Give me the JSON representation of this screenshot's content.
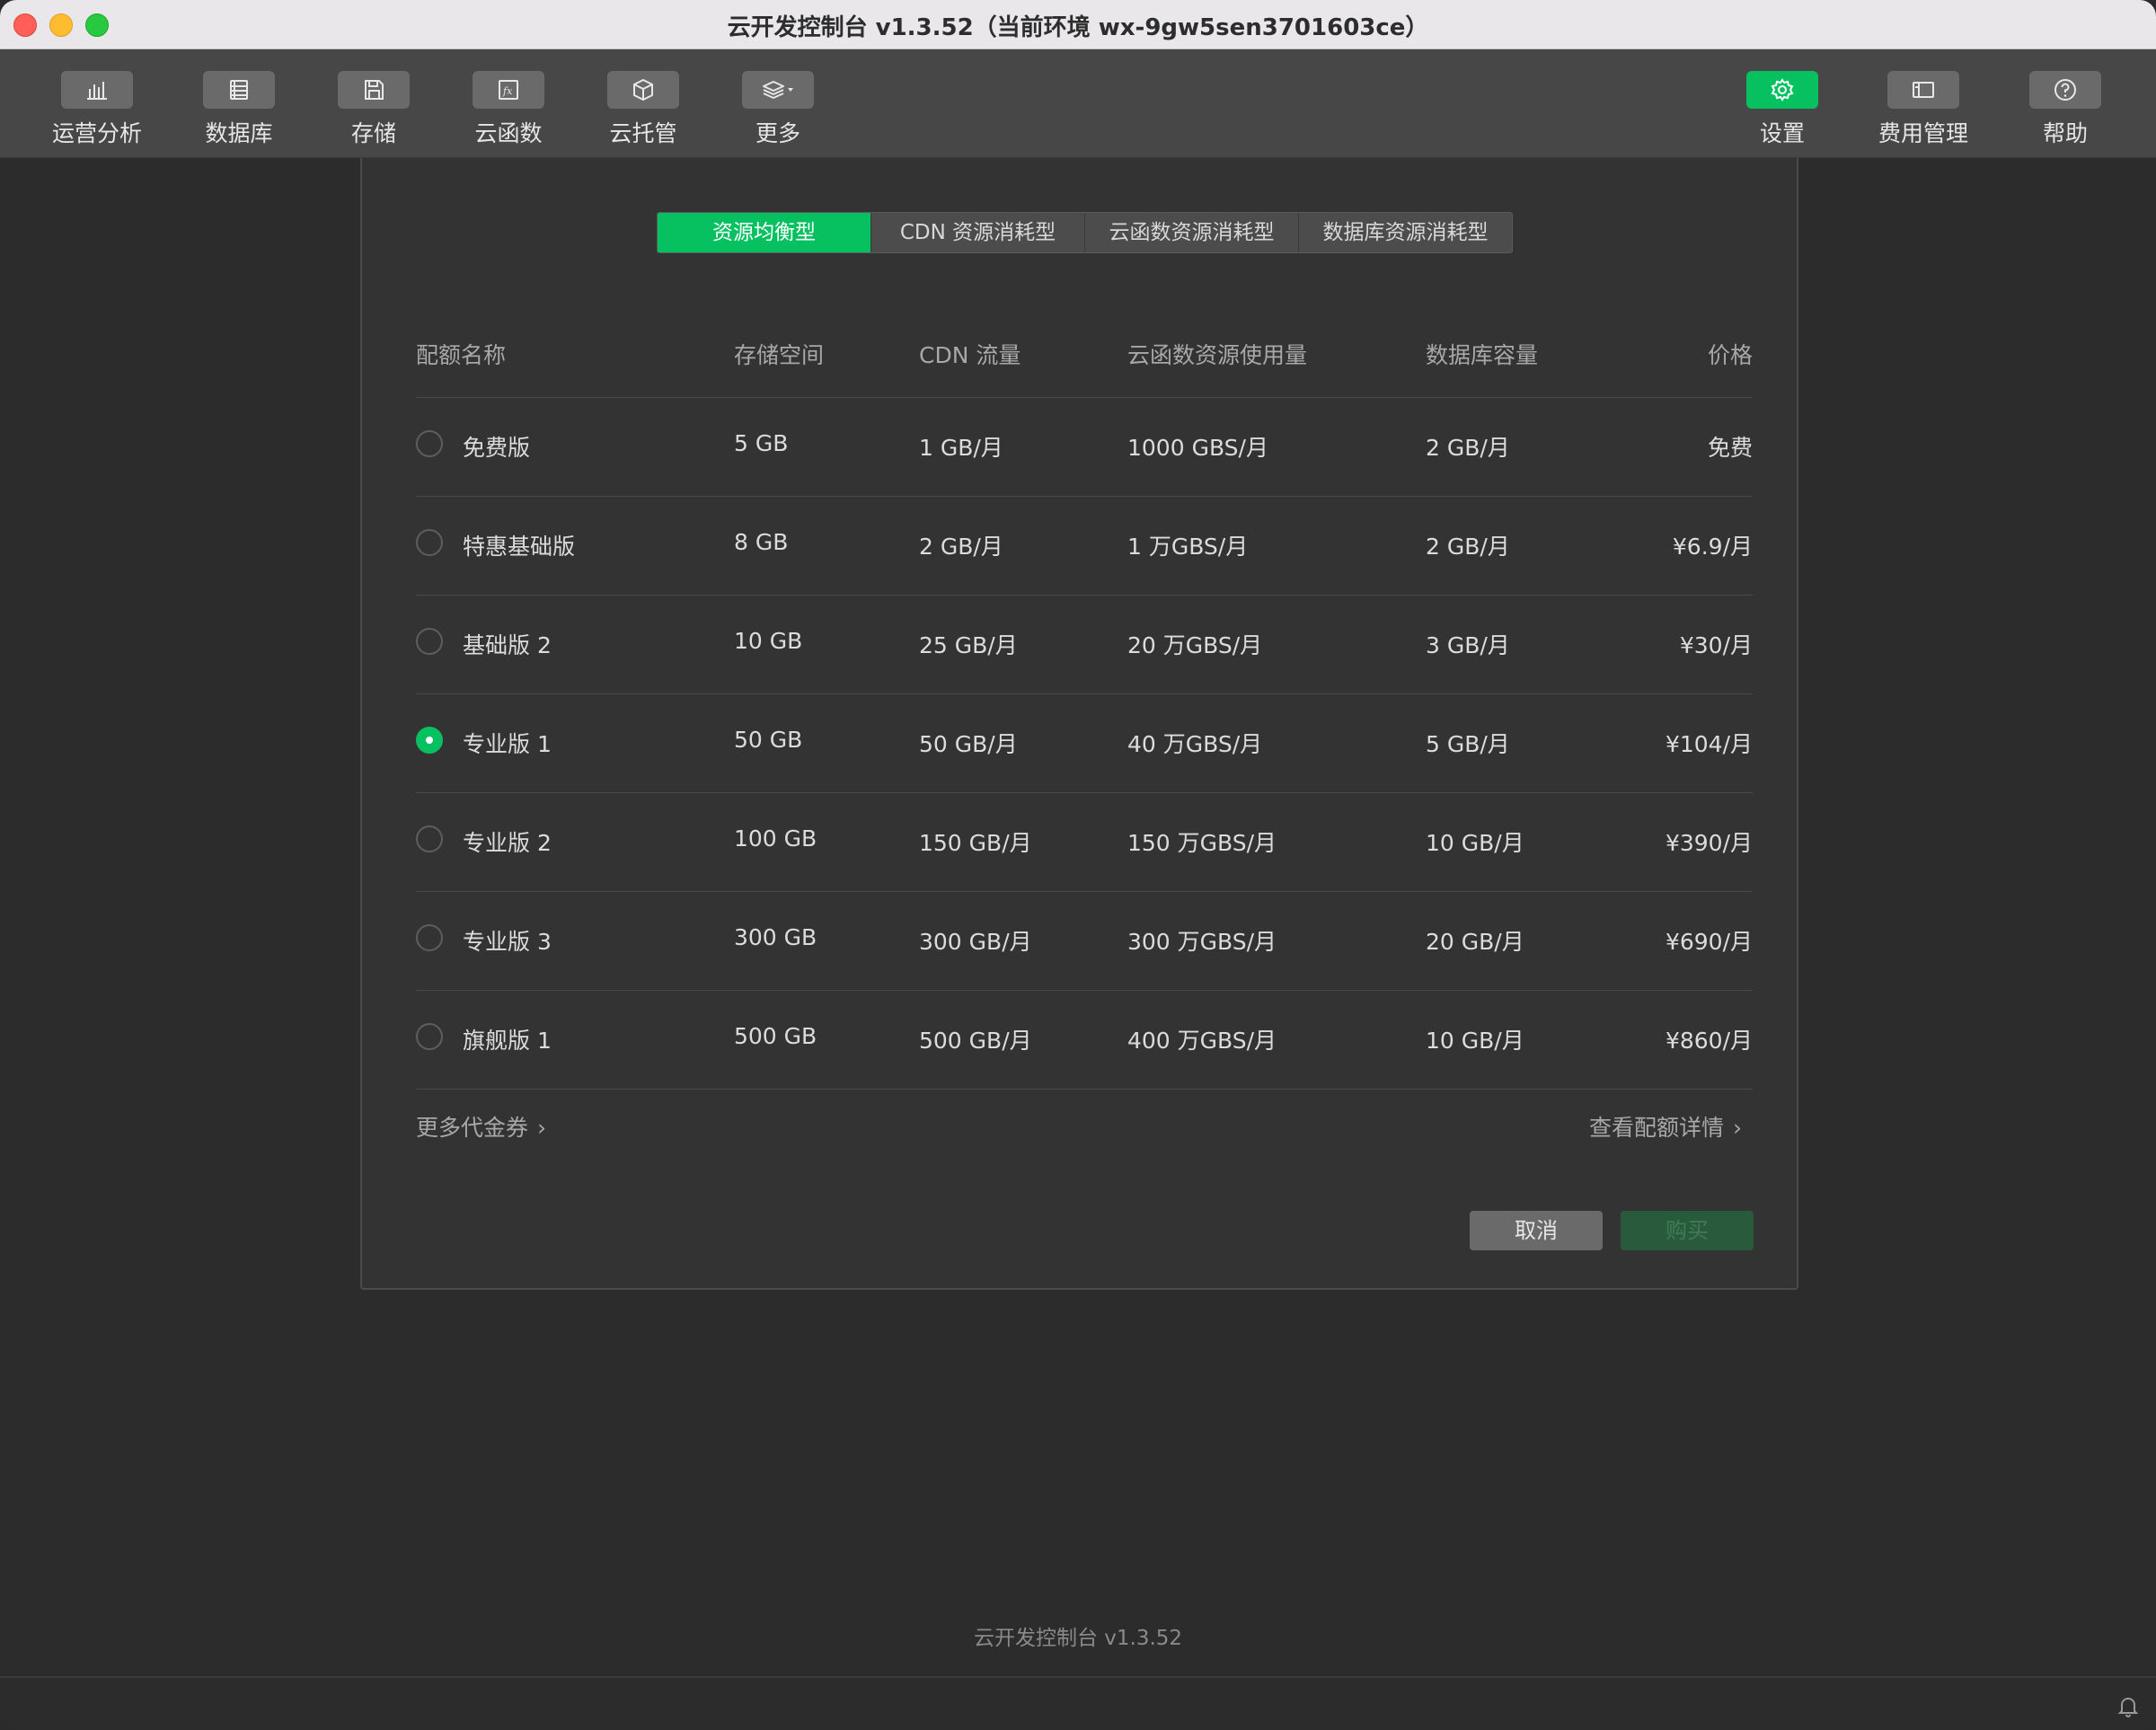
{
  "window": {
    "title": "云开发控制台 v1.3.52（当前环境 wx-9gw5sen3701603ce）"
  },
  "toolbar": {
    "left": [
      {
        "label": "运营分析",
        "icon": "bar-chart-icon"
      },
      {
        "label": "数据库",
        "icon": "database-icon"
      },
      {
        "label": "存储",
        "icon": "save-disk-icon"
      },
      {
        "label": "云函数",
        "icon": "function-icon"
      },
      {
        "label": "云托管",
        "icon": "cube-icon"
      },
      {
        "label": "更多",
        "icon": "layers-dropdown-icon"
      }
    ],
    "right": [
      {
        "label": "设置",
        "icon": "gear-icon",
        "active": true
      },
      {
        "label": "费用管理",
        "icon": "billing-icon"
      },
      {
        "label": "帮助",
        "icon": "help-icon"
      }
    ]
  },
  "plan_tabs": [
    "资源均衡型",
    "CDN 资源消耗型",
    "云函数资源消耗型",
    "数据库资源消耗型"
  ],
  "active_tab": "资源均衡型",
  "table": {
    "headers": [
      "配额名称",
      "存储空间",
      "CDN 流量",
      "云函数资源使用量",
      "数据库容量",
      "价格"
    ],
    "rows": [
      {
        "name": "免费版",
        "storage": "5 GB",
        "cdn": "1 GB/月",
        "functions": "1000 GBS/月",
        "db": "2 GB/月",
        "price": "免费",
        "selected": false
      },
      {
        "name": "特惠基础版",
        "storage": "8 GB",
        "cdn": "2 GB/月",
        "functions": "1 万GBS/月",
        "db": "2 GB/月",
        "price": "¥6.9/月",
        "selected": false
      },
      {
        "name": "基础版 2",
        "storage": "10 GB",
        "cdn": "25 GB/月",
        "functions": "20 万GBS/月",
        "db": "3 GB/月",
        "price": "¥30/月",
        "selected": false
      },
      {
        "name": "专业版 1",
        "storage": "50 GB",
        "cdn": "50 GB/月",
        "functions": "40 万GBS/月",
        "db": "5 GB/月",
        "price": "¥104/月",
        "selected": true
      },
      {
        "name": "专业版 2",
        "storage": "100 GB",
        "cdn": "150 GB/月",
        "functions": "150 万GBS/月",
        "db": "10 GB/月",
        "price": "¥390/月",
        "selected": false
      },
      {
        "name": "专业版 3",
        "storage": "300 GB",
        "cdn": "300 GB/月",
        "functions": "300 万GBS/月",
        "db": "20 GB/月",
        "price": "¥690/月",
        "selected": false
      },
      {
        "name": "旗舰版 1",
        "storage": "500 GB",
        "cdn": "500 GB/月",
        "functions": "400 万GBS/月",
        "db": "10 GB/月",
        "price": "¥860/月",
        "selected": false
      }
    ]
  },
  "links": {
    "more_coupons": "更多代金券",
    "quota_details": "查看配额详情",
    "chevron": "›"
  },
  "actions": {
    "cancel": "取消",
    "buy": "购买"
  },
  "footer": {
    "version": "云开发控制台 v1.3.52"
  },
  "colors": {
    "accent": "#07c160",
    "toolbar_bg": "#474747",
    "panel_bg": "#333333",
    "window_bg": "#2c2c2c"
  }
}
